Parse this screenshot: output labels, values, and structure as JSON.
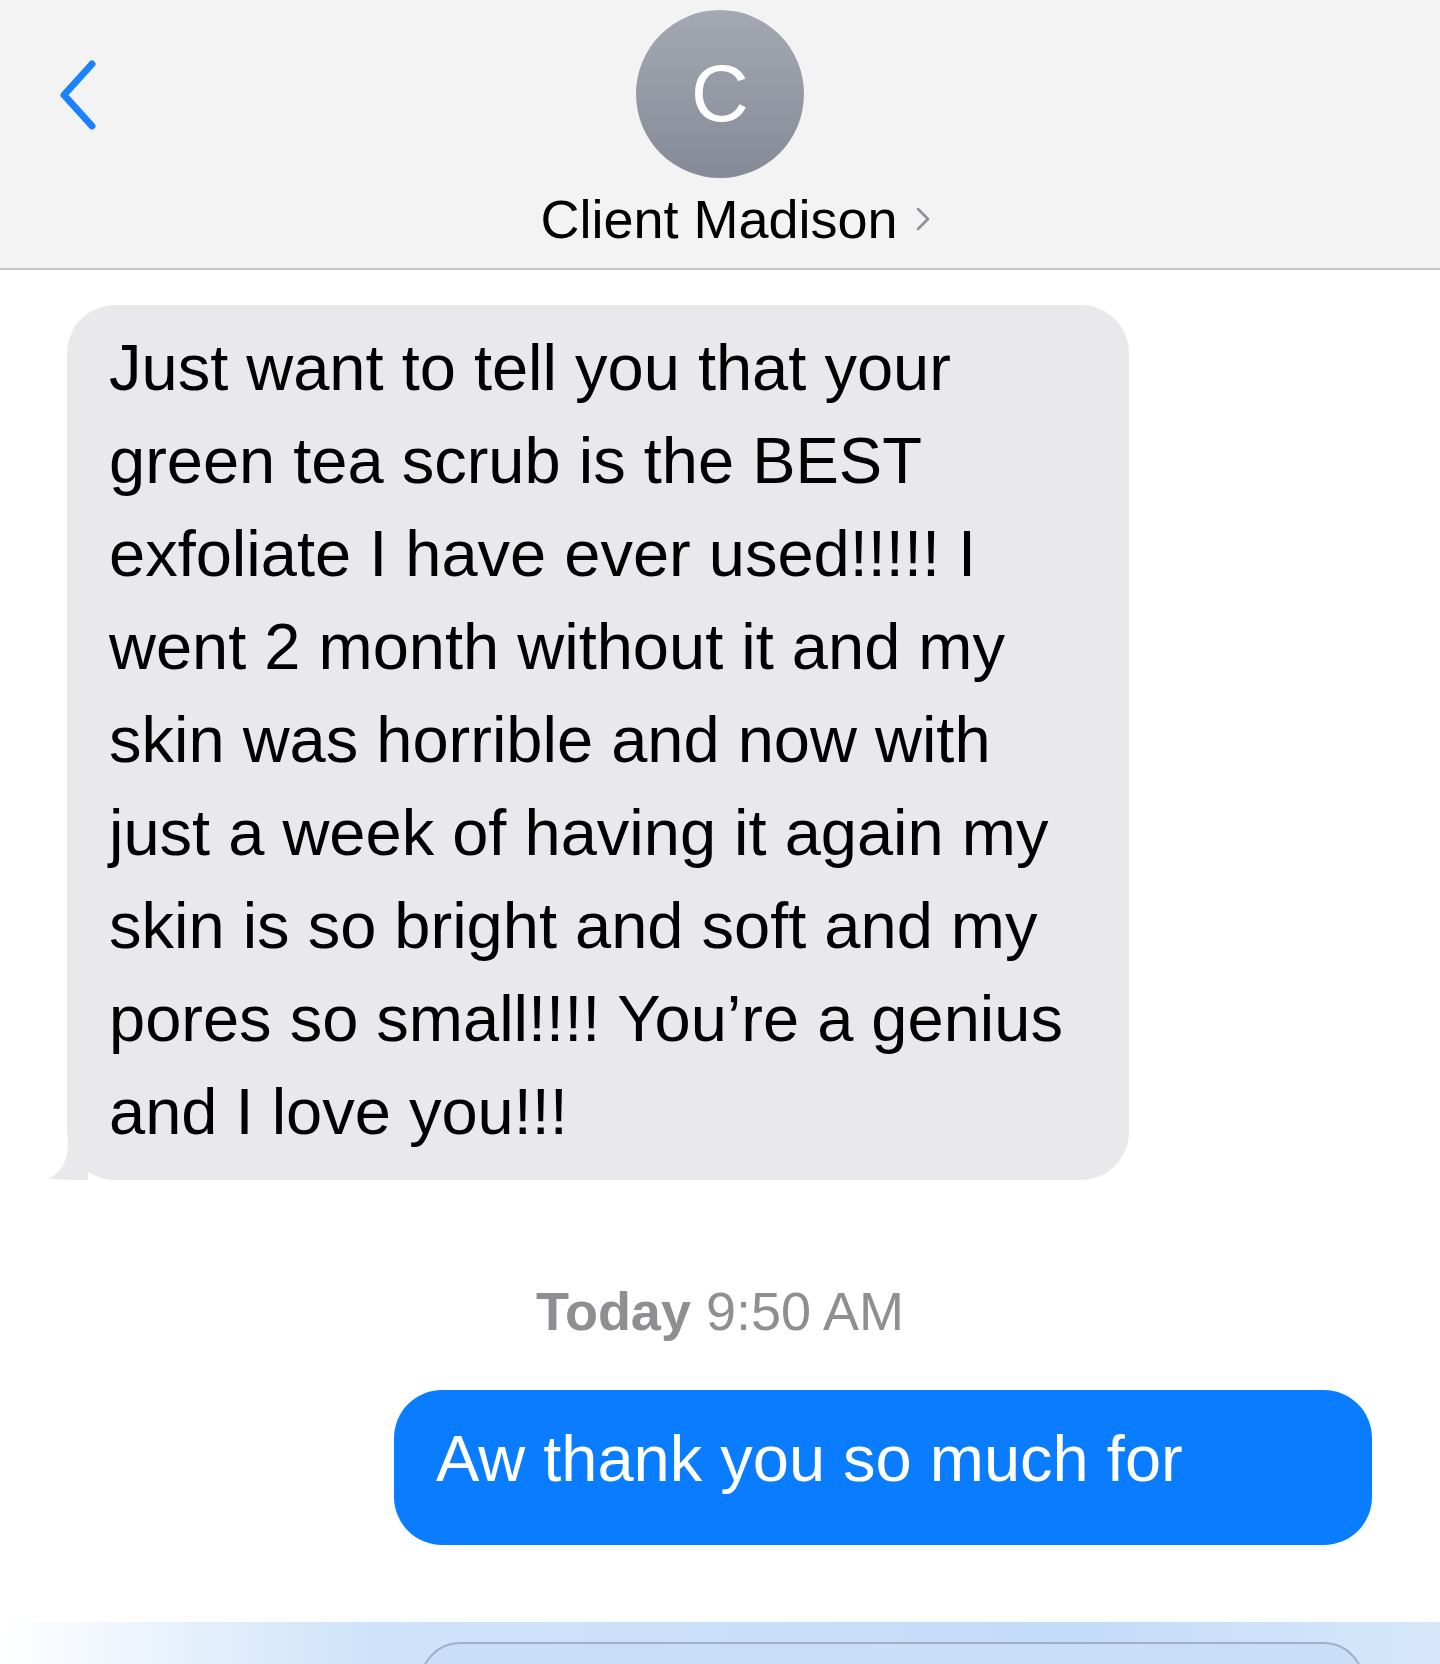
{
  "header": {
    "avatar_initial": "C",
    "contact_name": "Client Madison"
  },
  "messages": [
    {
      "kind": "incoming",
      "text": "Just want to tell you that your green tea scrub is the BEST exfoliate I have ever used!!!!! I went 2 month without it and my skin was horrible and now with just a week of having it again my skin is so bright and soft and my pores so small!!!! You’re a genius and I love you!!!"
    },
    {
      "kind": "timestamp",
      "day": "Today",
      "time": "9:50 AM"
    },
    {
      "kind": "outgoing",
      "text": "Aw thank you so much for"
    }
  ]
}
